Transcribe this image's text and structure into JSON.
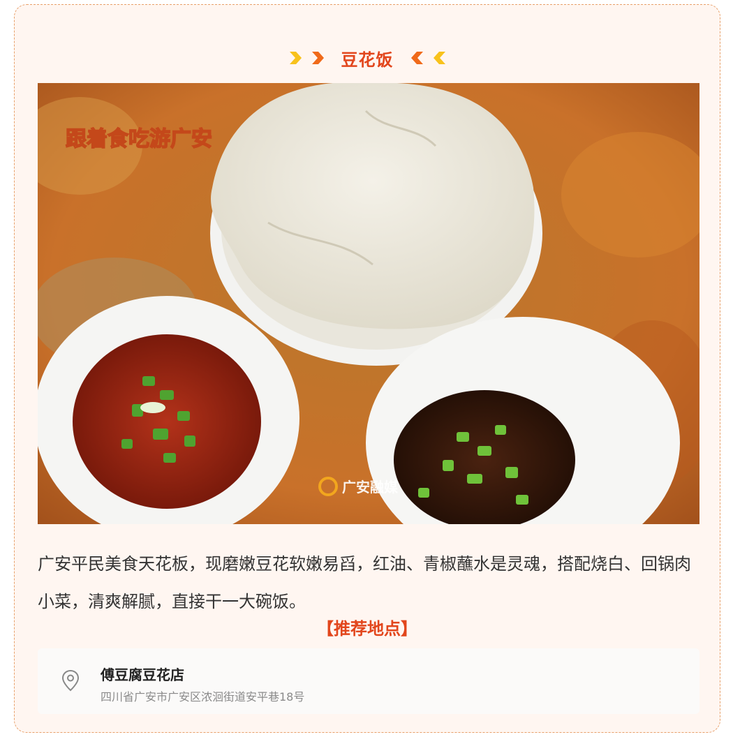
{
  "section": {
    "title": "豆花饭"
  },
  "photo": {
    "logo_text": "跟着食吃游广安",
    "watermark_text": "广安融媒"
  },
  "description": "广安平民美食天花板，现磨嫩豆花软嫩易舀，红油、青椒蘸水是灵魂，搭配烧白、回锅肉小菜，清爽解腻，直接干一大碗饭。",
  "recommend_label": "【推荐地点】",
  "location": {
    "icon": "map-pin-icon",
    "name": "傅豆腐豆花店",
    "address": "四川省广安市广安区浓洄街道安平巷18号"
  },
  "colors": {
    "accent": "#e2461c",
    "chevron_yellow": "#f8c21c",
    "chevron_orange": "#f06a1a",
    "card_bg": "#fff6f1"
  }
}
